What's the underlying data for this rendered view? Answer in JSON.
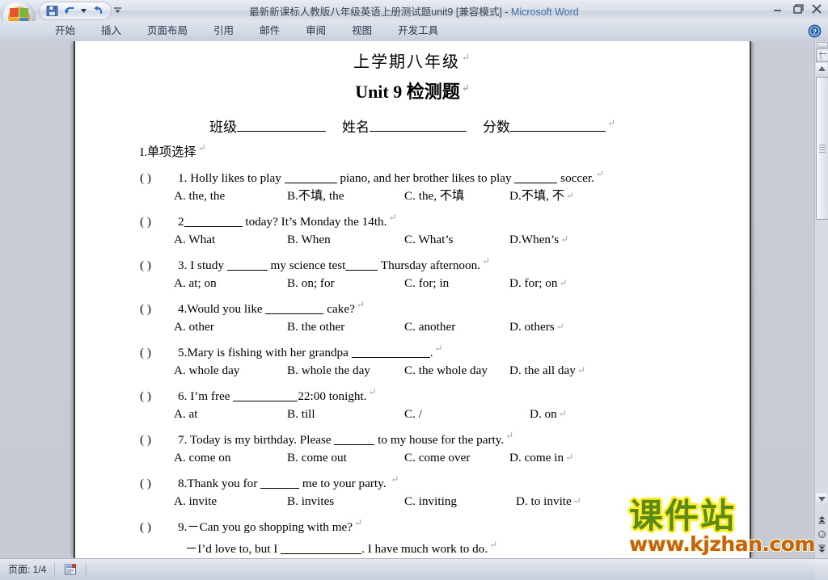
{
  "window": {
    "title_doc": "最新新课标人教版八年级英语上册测试题unit9 [兼容模式]",
    "title_sep": " - ",
    "title_app": "Microsoft Word",
    "minimize_label": "最小化",
    "restore_label": "向下还原",
    "close_label": "关闭"
  },
  "quick_access": {
    "save_label": "保存",
    "undo_label": "撤消",
    "undo_dropdown_label": "撤消下拉",
    "redo_label": "恢复",
    "customize_label": "自定义快速访问工具栏"
  },
  "ribbon": {
    "tabs": [
      {
        "label": "开始"
      },
      {
        "label": "插入"
      },
      {
        "label": "页面布局"
      },
      {
        "label": "引用"
      },
      {
        "label": "邮件"
      },
      {
        "label": "审阅"
      },
      {
        "label": "视图"
      },
      {
        "label": "开发工具"
      }
    ],
    "help_label": "Microsoft Office Word 帮助"
  },
  "document": {
    "heading_line1": "上学期八年级",
    "heading_line2": "Unit 9 检测题",
    "info_fields": [
      {
        "label": "班级"
      },
      {
        "label": "姓名"
      },
      {
        "label": "分数"
      }
    ],
    "section_title": "I.单项选择",
    "questions": [
      {
        "paren": "(       )",
        "stem_1": "1. Holly likes to play ",
        "stem_2": " piano, and her brother likes to play ",
        "stem_3": " soccer.",
        "options": [
          "A. the, the",
          "B.不填, the",
          "C. the, 不填",
          "D.不填, 不"
        ]
      },
      {
        "paren": "(       )",
        "stem_1": "2",
        "stem_2": " today? It’s Monday the 14th.",
        "stem_3": "",
        "options": [
          "A. What",
          "B. When",
          "C. What’s",
          "D.When’s"
        ]
      },
      {
        "paren": "(       )",
        "stem_1": "3. I study ",
        "stem_2": " my science test",
        "stem_3": " Thursday afternoon.",
        "options": [
          "A. at; on",
          "B. on; for",
          "C. for; in",
          "D. for; on"
        ]
      },
      {
        "paren": "(       )",
        "stem_1": "4.Would you like ",
        "stem_2": " cake?",
        "stem_3": "",
        "options": [
          "A. other",
          "B. the other",
          "C. another",
          "D. others"
        ]
      },
      {
        "paren": "(       )",
        "stem_1": "5.Mary is fishing with her grandpa ",
        "stem_2": ".",
        "stem_3": "",
        "options": [
          "A. whole day",
          "B. whole the day",
          "C. the whole day",
          "D. the all day"
        ]
      },
      {
        "paren": "(       )",
        "stem_1": "6. I’m free ",
        "stem_2": "22:00 tonight.",
        "stem_3": "",
        "options": [
          "A. at",
          "B. till",
          "C. /",
          "D. on"
        ]
      },
      {
        "paren": "(       )",
        "stem_1": "7. Today is my birthday. Please ",
        "stem_2": " to my house for the party.",
        "stem_3": "",
        "options": [
          "A. come on",
          "B. come out",
          "C. come over",
          "D. come in"
        ]
      },
      {
        "paren": "(       )",
        "stem_1": "8.Thank you for ",
        "stem_2": " me to your party. ",
        "stem_3": "",
        "options": [
          "A. invite",
          "B. invites",
          "C. inviting",
          "D. to invite"
        ]
      },
      {
        "paren": "(       )",
        "stem_1": "9.－Can you go shopping with me?",
        "stem_2": "",
        "stem_3": "",
        "options": []
      }
    ],
    "q9_answer_1": "－I’d love to, but I ",
    "q9_answer_2": ". I have much work to do.",
    "pilcrow": "↵"
  },
  "watermark": {
    "brand": "课件站",
    "url": "www.kjzhan.com",
    "brand_color": "#5c8a12",
    "brand_outline": "#ffef2e",
    "url_color": "#c4620d"
  },
  "scrollbar": {
    "split_label": "拆分",
    "ruler_label": "标尺",
    "up_label": "向上滚动",
    "down_label": "向下滚动",
    "prev_page_label": "前一页",
    "browse_object_label": "选择浏览对象",
    "next_page_label": "后一页",
    "thumb_label": "垂直滚动条滑块"
  },
  "statusbar": {
    "page_label": "页面: 1/4",
    "proofing_label": "拼写和语法检查"
  }
}
